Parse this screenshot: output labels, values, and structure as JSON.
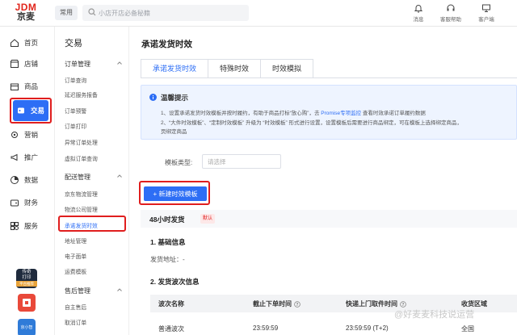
{
  "brand": {
    "logo_top": "JDM",
    "logo_bottom": "京麦"
  },
  "header": {
    "fav_label": "常用",
    "search_placeholder": "小店开店必备秘籍",
    "tools": [
      {
        "label": "消息",
        "icon": "bell-icon"
      },
      {
        "label": "客服帮助",
        "icon": "headset-icon"
      },
      {
        "label": "客户端",
        "icon": "monitor-icon"
      }
    ]
  },
  "leftnav": {
    "items": [
      {
        "key": "home",
        "label": "首页",
        "icon": "home-icon"
      },
      {
        "key": "store",
        "label": "店铺",
        "icon": "store-icon"
      },
      {
        "key": "goods",
        "label": "商品",
        "icon": "box-icon"
      },
      {
        "key": "trade",
        "label": "交易",
        "icon": "trade-icon"
      },
      {
        "key": "marketing",
        "label": "营销",
        "icon": "gear-icon"
      },
      {
        "key": "promo",
        "label": "推广",
        "icon": "megaphone-icon"
      },
      {
        "key": "data",
        "label": "数据",
        "icon": "chart-icon"
      },
      {
        "key": "finance",
        "label": "财务",
        "icon": "wallet-icon"
      },
      {
        "key": "service",
        "label": "服务",
        "icon": "service-icon"
      }
    ],
    "active": "trade",
    "app_badge_text_1": "传奇",
    "app_badge_text_2": "打印",
    "app_badge_text_3": "平台推荐",
    "app_badge2_text": "京小智"
  },
  "submenu": {
    "title": "交易",
    "groups": [
      {
        "label": "订单管理",
        "items": [
          "订单查询",
          "延迟服务报备",
          "订单预警",
          "订单打印",
          "异常订单处理",
          "虚拟订单查询"
        ]
      },
      {
        "label": "配送管理",
        "items": [
          "京东物流管理",
          "物流公司管理",
          "承诺发货时效",
          "地址管理",
          "电子面单",
          "运费模板"
        ]
      },
      {
        "label": "售后管理",
        "items": [
          "自主售后",
          "取消订单"
        ]
      }
    ],
    "active_item": "承诺发货时效"
  },
  "content": {
    "page_title": "承诺发货时效",
    "tabs": [
      "承诺发货时效",
      "特殊时效",
      "时效模拟"
    ],
    "active_tab": 0,
    "tips": {
      "title": "温馨提示",
      "line1_a": "1、设置承诺发货时效模板并按时履约，有助于商品打标“放心购”，去",
      "line1_link": "Promise专项监控",
      "line1_b": "查看时效承诺订单履约数据",
      "line2": "2、“大件时效模板”、“定制时效模板” 升级为 “时效模板” 形式进行设置，设置模板后需要进行商品绑定，可在模板上选择绑定商品，",
      "line3": "页绑定商品"
    },
    "filter": {
      "label": "模板类型:",
      "placeholder": "请选择"
    },
    "new_button": "+ 新建时效模板",
    "section": {
      "title": "48小时发货",
      "badge": "默认"
    },
    "basic_info": {
      "heading": "1. 基础信息",
      "ship_addr_label": "发货地址：-"
    },
    "waves": {
      "heading": "2. 发货波次信息",
      "columns": [
        "波次名称",
        "截止下单时间",
        "快递上门取件时间",
        "收货区域"
      ],
      "rows": [
        {
          "name": "普通波次",
          "cutoff": "23:59:59",
          "pickup": "23:59:59 (T+2)",
          "area": "全国"
        }
      ]
    }
  },
  "watermark": "@好麦麦科技说运营",
  "colors": {
    "primary": "#2d6ef5",
    "highlight": "#e01e1e"
  }
}
